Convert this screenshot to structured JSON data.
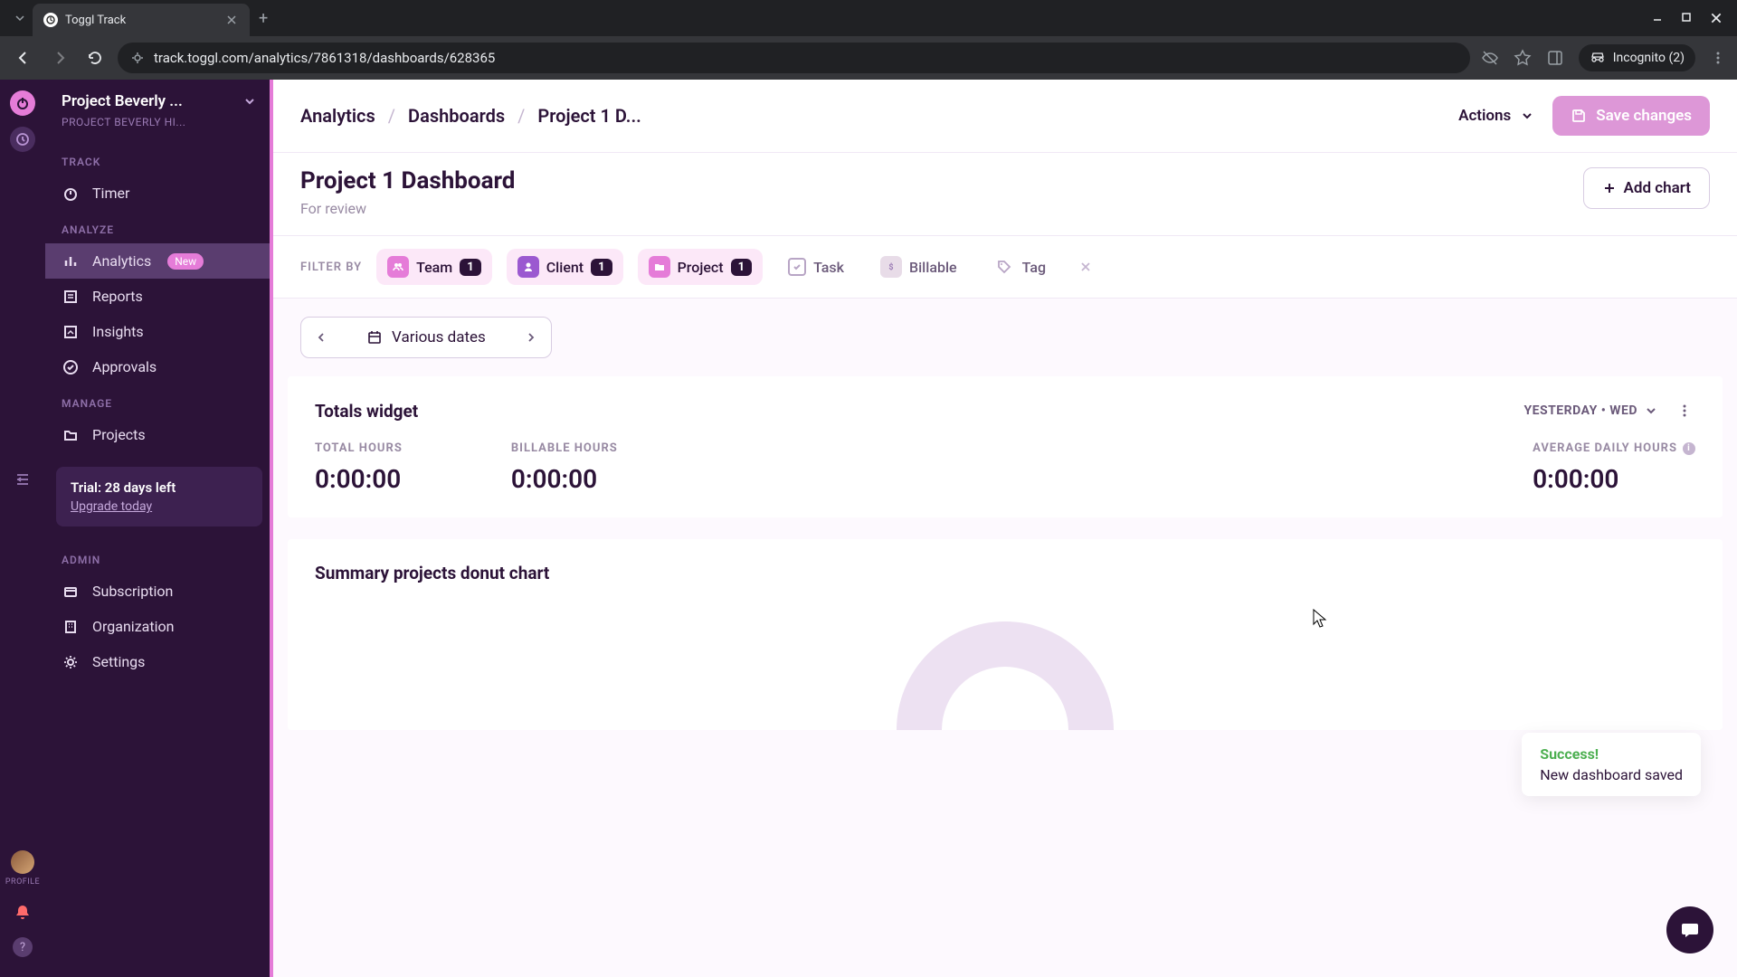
{
  "browser": {
    "tab_title": "Toggl Track",
    "url": "track.toggl.com/analytics/7861318/dashboards/628365",
    "incognito": "Incognito (2)"
  },
  "workspace": {
    "name": "Project Beverly ...",
    "subtitle": "PROJECT BEVERLY HI..."
  },
  "sidebar": {
    "sections": {
      "track": "TRACK",
      "analyze": "ANALYZE",
      "manage": "MANAGE",
      "admin": "ADMIN"
    },
    "items": {
      "timer": "Timer",
      "analytics": "Analytics",
      "analytics_badge": "New",
      "reports": "Reports",
      "insights": "Insights",
      "approvals": "Approvals",
      "projects": "Projects",
      "subscription": "Subscription",
      "organization": "Organization",
      "settings": "Settings"
    },
    "trial": {
      "title": "Trial: 28 days left",
      "link": "Upgrade today"
    },
    "profile_label": "PROFILE"
  },
  "breadcrumb": {
    "a": "Analytics",
    "b": "Dashboards",
    "c": "Project 1 D..."
  },
  "header": {
    "actions": "Actions",
    "save": "Save changes",
    "add_chart": "Add chart"
  },
  "page": {
    "title": "Project 1 Dashboard",
    "subtitle": "For review"
  },
  "filters": {
    "label": "FILTER BY",
    "team": "Team",
    "team_count": "1",
    "client": "Client",
    "client_count": "1",
    "project": "Project",
    "project_count": "1",
    "task": "Task",
    "billable": "Billable",
    "tag": "Tag"
  },
  "date": {
    "label": "Various dates"
  },
  "totals_widget": {
    "title": "Totals widget",
    "date_label": "YESTERDAY • WED",
    "total_hours_label": "TOTAL HOURS",
    "total_hours": "0:00:00",
    "billable_hours_label": "BILLABLE HOURS",
    "billable_hours": "0:00:00",
    "avg_hours_label": "AVERAGE DAILY HOURS",
    "avg_hours": "0:00:00"
  },
  "donut_widget": {
    "title": "Summary projects donut chart"
  },
  "toast": {
    "title": "Success!",
    "body": "New dashboard saved"
  }
}
